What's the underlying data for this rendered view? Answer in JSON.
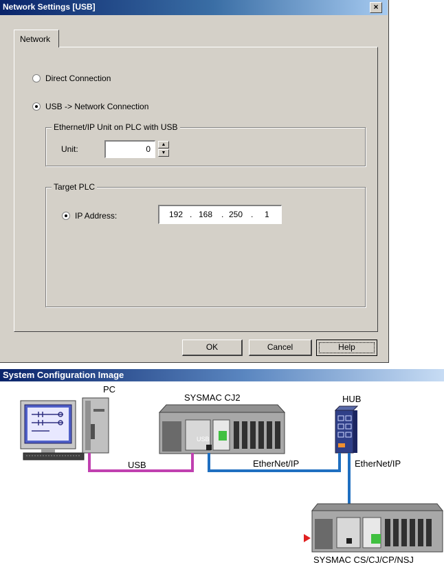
{
  "dialog": {
    "title": "Network Settings [USB]",
    "close_glyph": "×",
    "tab_label": "Network",
    "direct_connection_label": "Direct Connection",
    "usb_network_label": "USB -> Network Connection",
    "selected_connection": "usb_network",
    "ethernet_group": {
      "title": "Ethernet/IP Unit on PLC with USB",
      "unit_label": "Unit:",
      "unit_value": "0"
    },
    "target_group": {
      "title": "Target PLC",
      "ip_label": "IP Address:",
      "ip_octets": [
        "192",
        "168",
        "250",
        "1"
      ],
      "ip_separator": "."
    },
    "buttons": {
      "ok": "OK",
      "cancel": "Cancel",
      "help": "Help"
    }
  },
  "system_config": {
    "title": "System Configuration Image",
    "labels": {
      "pc": "PC",
      "plc_cj2": "SYSMAC CJ2",
      "hub": "HUB",
      "usb_link": "USB",
      "ethernet_link_1": "EtherNet/IP",
      "ethernet_link_2": "EtherNet/IP",
      "target_plc": "SYSMAC CS/CJ/CP/NSJ",
      "usb_port": "USB"
    },
    "colors": {
      "usb_cable": "#c040b0",
      "ethernet_cable": "#1f6fc0",
      "marker": "#e02020"
    }
  }
}
